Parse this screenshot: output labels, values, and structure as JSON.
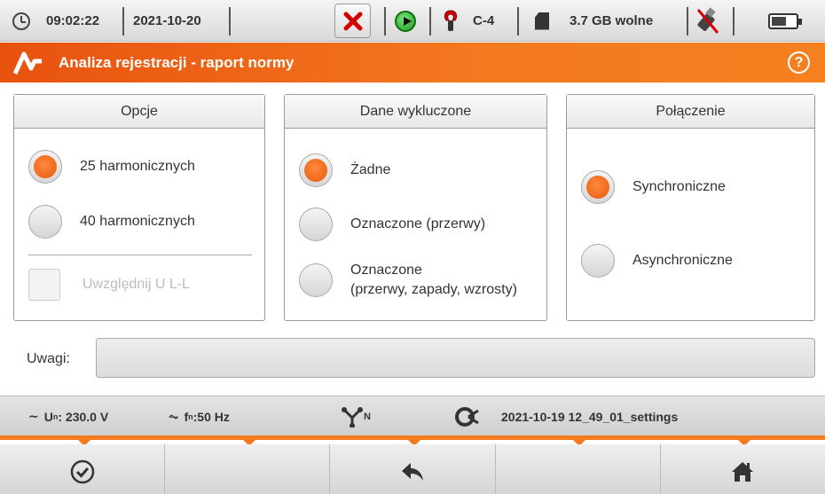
{
  "status": {
    "time": "09:02:22",
    "date": "2021-10-20",
    "clamp": "C-4",
    "storage": "3.7 GB wolne"
  },
  "titlebar": {
    "title": "Analiza rejestracji - raport normy",
    "help": "?"
  },
  "panels": {
    "opcje": {
      "header": "Opcje",
      "options": [
        "25 harmonicznych",
        "40 harmonicznych"
      ],
      "selected": 0,
      "checkbox_label": "Uwzględnij U L-L"
    },
    "dane": {
      "header": "Dane wykluczone",
      "options": [
        "Żadne",
        "Oznaczone (przerwy)",
        "Oznaczone",
        "(przerwy, zapady, wzrosty)"
      ],
      "selected": 0
    },
    "polaczenie": {
      "header": "Połączenie",
      "options": [
        "Synchroniczne",
        "Asynchroniczne"
      ],
      "selected": 0
    }
  },
  "remarks": {
    "label": "Uwagi:",
    "value": ""
  },
  "infobar": {
    "un": "U",
    "un_sub": "n",
    "un_value": ": 230.0 V",
    "fn": "f",
    "fn_sub": "n",
    "fn_value": ":50 Hz",
    "network_sub": "N",
    "settings": "2021-10-19 12_49_01_settings"
  },
  "colors": {
    "accent": "#f47a20",
    "radio_on": "#e85a0c"
  }
}
